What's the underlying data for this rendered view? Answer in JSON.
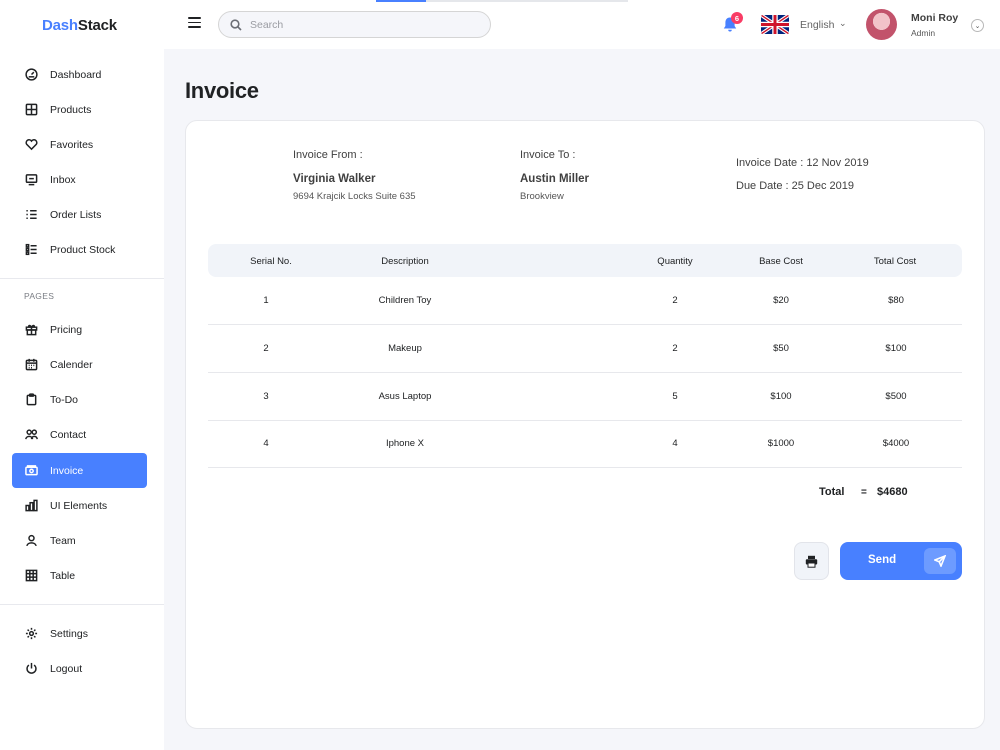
{
  "brand": {
    "accent": "Dash",
    "rest": "Stack",
    "accent_color": "#4880ff"
  },
  "search": {
    "placeholder": "Search",
    "value": ""
  },
  "notifications": {
    "count": "6"
  },
  "language": {
    "label": "English"
  },
  "user": {
    "name": "Moni Roy",
    "role": "Admin"
  },
  "sidebar": {
    "main_items": [
      {
        "label": "Dashboard",
        "icon": "dashboard-icon"
      },
      {
        "label": "Products",
        "icon": "grid-icon"
      },
      {
        "label": "Favorites",
        "icon": "heart-icon"
      },
      {
        "label": "Inbox",
        "icon": "inbox-icon"
      },
      {
        "label": "Order Lists",
        "icon": "list-icon"
      },
      {
        "label": "Product Stock",
        "icon": "stock-icon"
      }
    ],
    "section_label": "PAGES",
    "page_items": [
      {
        "label": "Pricing",
        "icon": "gift-icon"
      },
      {
        "label": "Calender",
        "icon": "calendar-icon"
      },
      {
        "label": "To-Do",
        "icon": "clipboard-icon"
      },
      {
        "label": "Contact",
        "icon": "users-icon"
      },
      {
        "label": "Invoice",
        "icon": "invoice-icon",
        "active": true
      },
      {
        "label": "UI Elements",
        "icon": "chart-icon"
      },
      {
        "label": "Team",
        "icon": "user-icon"
      },
      {
        "label": "Table",
        "icon": "table-icon"
      }
    ],
    "bottom_items": [
      {
        "label": "Settings",
        "icon": "gear-icon"
      },
      {
        "label": "Logout",
        "icon": "power-icon"
      }
    ]
  },
  "page": {
    "title": "Invoice"
  },
  "invoice": {
    "from": {
      "label": "Invoice From :",
      "name": "Virginia Walker",
      "address": "9694 Krajcik Locks Suite 635"
    },
    "to": {
      "label": "Invoice To :",
      "name": "Austin Miller",
      "address": "Brookview"
    },
    "invoice_date": "Invoice Date : 12 Nov 2019",
    "due_date": "Due Date : 25 Dec 2019",
    "columns": [
      "Serial No.",
      "Description",
      "Quantity",
      "Base Cost",
      "Total Cost"
    ],
    "rows": [
      [
        "1",
        "Children Toy",
        "2",
        "$20",
        "$80"
      ],
      [
        "2",
        "Makeup",
        "2",
        "$50",
        "$100"
      ],
      [
        "3",
        "Asus Laptop",
        "5",
        "$100",
        "$500"
      ],
      [
        "4",
        "Iphone X",
        "4",
        "$1000",
        "$4000"
      ]
    ],
    "total_label": "Total",
    "total_eq": "=",
    "total_value": "$4680"
  },
  "actions": {
    "send_label": "Send"
  }
}
